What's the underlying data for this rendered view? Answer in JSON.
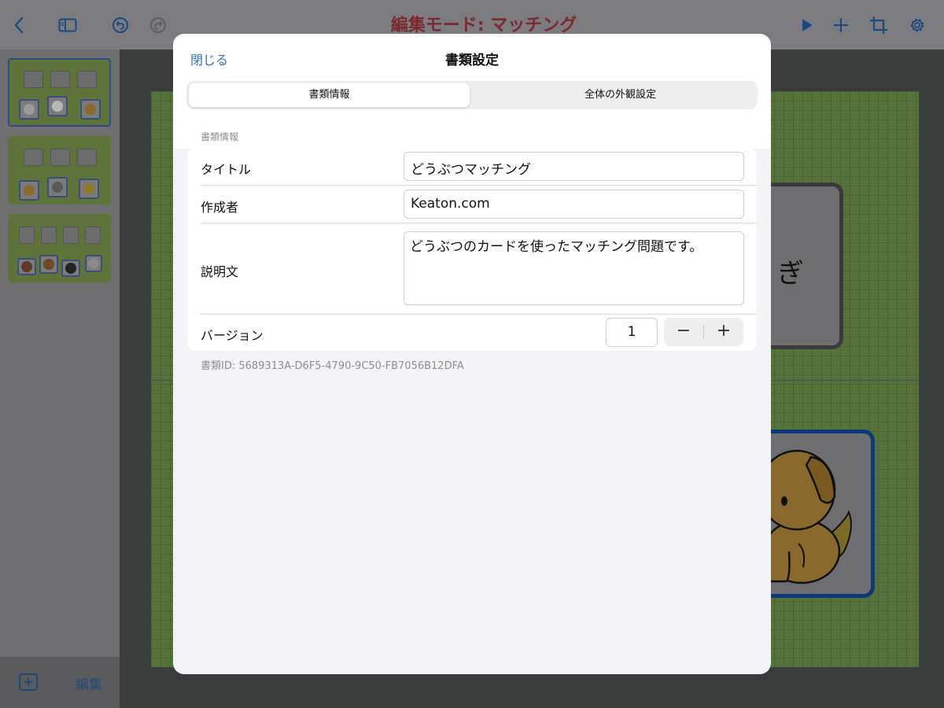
{
  "toolbar": {
    "title": "編集モード: マッチング",
    "icons": [
      "back-chevron-icon",
      "sidebar-toggle-icon",
      "undo-icon",
      "redo-icon",
      "play-icon",
      "plus-icon",
      "crop-transform-icon",
      "gear-icon"
    ],
    "title_color": "#7a2a2e",
    "accent_color": "#1e4a7a"
  },
  "sidebar": {
    "edit_label": "編集",
    "pages": [
      {
        "labels": [
          "いぬ",
          "ねこ",
          "うさぎ"
        ],
        "animals": [
          "cat",
          "rabbit",
          "dog"
        ]
      },
      {
        "labels": [
          "ゾウ",
          "ライオン",
          "キリン"
        ],
        "animals": [
          "lion",
          "elephant",
          "giraffe"
        ]
      },
      {
        "labels": [
          "ウマ",
          "カバ",
          "ウシ",
          "ネズミ"
        ],
        "animals": [
          "hippo",
          "horse",
          "cow",
          "mouse"
        ]
      }
    ]
  },
  "canvas": {
    "word_card_text": "ぎ"
  },
  "modal": {
    "close_label": "閉じる",
    "title": "書類設定",
    "tabs": [
      "書類情報",
      "全体の外観設定"
    ],
    "section_label": "書類情報",
    "rows": {
      "title_label": "タイトル",
      "title_value": "どうぶつマッチング",
      "author_label": "作成者",
      "author_value": "Keaton.com",
      "desc_label": "説明文",
      "desc_value": "どうぶつのカードを使ったマッチング問題です。",
      "version_label": "バージョン",
      "version_value": "1"
    },
    "stepper": {
      "minus": "−",
      "plus": "+"
    },
    "doc_id": "書類ID: 5689313A-D6F5-4790-9C50-FB7056B12DFA",
    "link_color": "#2f73c8"
  }
}
